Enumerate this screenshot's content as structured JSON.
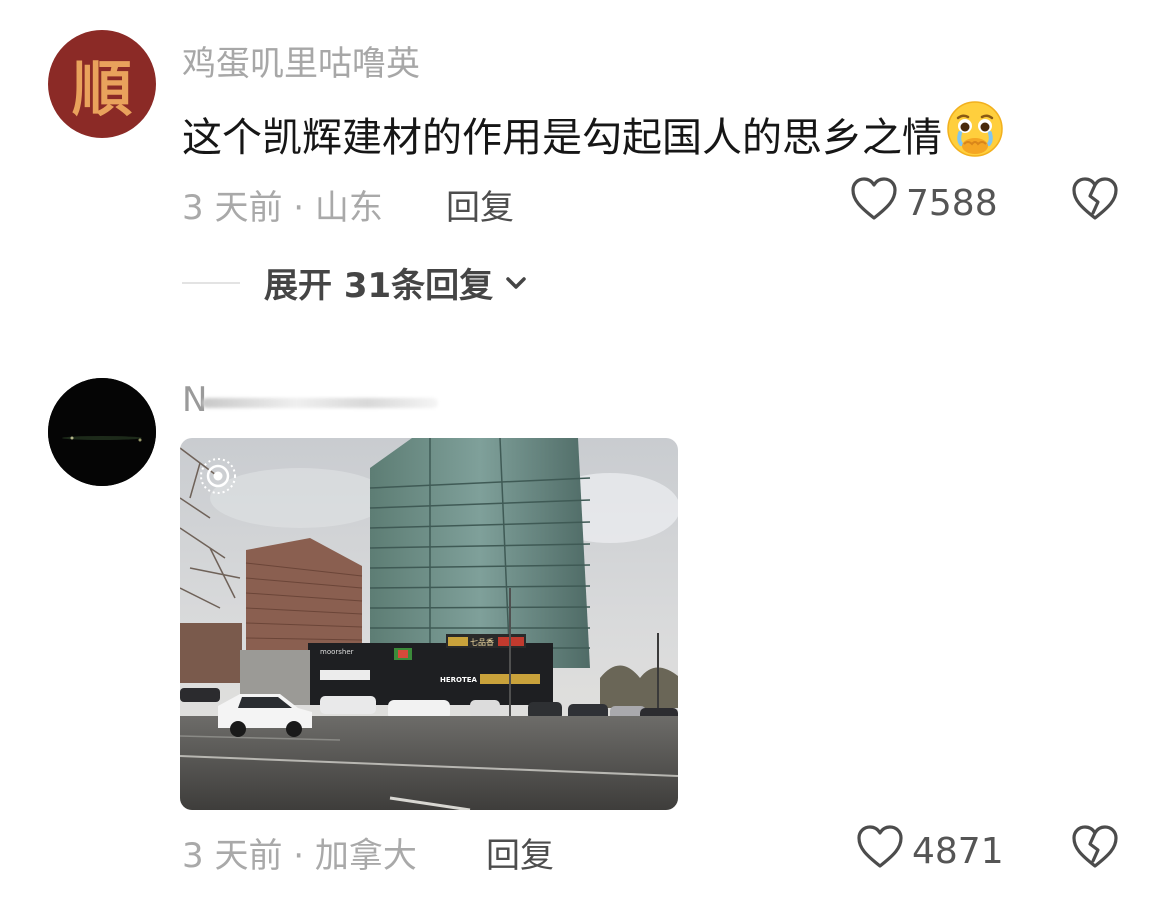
{
  "comments": [
    {
      "username": "鸡蛋叽里咕噜英",
      "avatar_char": "順",
      "text": "这个凯辉建材的作用是勾起国人的思乡之情",
      "meta": "3 天前 · 山东",
      "reply_label": "回复",
      "likes": "7588",
      "expand_label": "展开 31条回复"
    },
    {
      "username": "N",
      "meta": "3 天前 · 加拿大",
      "reply_label": "回复",
      "likes": "4871",
      "image_signs": [
        "七品香",
        "HEROTEA",
        "moorsher"
      ]
    }
  ],
  "colors": {
    "avatar_red": "#8b2a26",
    "avatar_char": "#e9a25c",
    "muted": "#a9a9a9",
    "text": "#161616"
  },
  "icons": [
    "heart-outline-icon",
    "broken-heart-icon",
    "chevron-down-icon",
    "live-photo-icon"
  ]
}
